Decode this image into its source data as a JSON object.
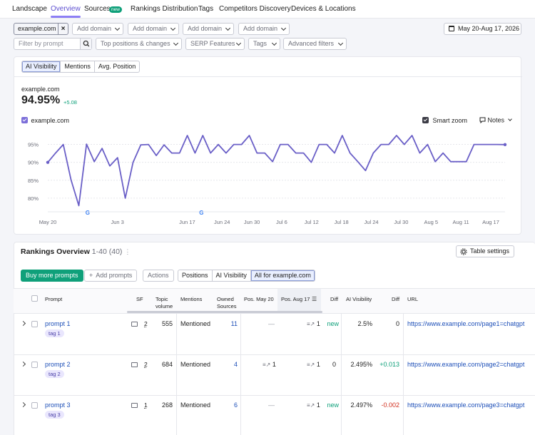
{
  "nav": {
    "tabs": [
      "Landscape",
      "Overview",
      "Sources",
      "Rankings Distribution",
      "Tags",
      "Competitors Discovery",
      "Devices & Locations"
    ],
    "active": "Overview",
    "new_badge": "new"
  },
  "filters": {
    "domain_chip": "example.com",
    "add_domain": "Add domain",
    "date_range": "May 20-Aug 17, 2026",
    "prompt_placeholder": "Filter by prompt",
    "top_positions": "Top positions & changes",
    "serp_features": "SERP Features",
    "tags": "Tags",
    "advanced_filters": "Advanced filters"
  },
  "chart_tabs": [
    "AI Visibility",
    "Mentions",
    "Avg. Position"
  ],
  "summary": {
    "domain": "example.com",
    "value": "94.95%",
    "change": "+5.08",
    "legend_label": "example.com",
    "smart_zoom": "Smart zoom",
    "notes": "Notes"
  },
  "colors": {
    "accent": "#7c6fd9",
    "line": "#6a5fc7",
    "green": "#0fa07a",
    "link": "#1d4fb8",
    "negative": "#d1301f"
  },
  "chart_data": {
    "type": "line",
    "series": [
      {
        "name": "example.com",
        "values": [
          90.0,
          92.6,
          95.0,
          85.1,
          77.9,
          95.1,
          90.2,
          93.9,
          89.0,
          91.3,
          80.0,
          90.0,
          94.9,
          95.0,
          91.9,
          94.9,
          92.6,
          92.6,
          97.5,
          92.6,
          97.5,
          92.6,
          95.0,
          92.6,
          95.0,
          95.0,
          97.5,
          92.6,
          92.6,
          90.2,
          95.0,
          95.0,
          92.6,
          92.6,
          90.0,
          95.0,
          95.0,
          92.6,
          97.5,
          92.6,
          90.2,
          87.7,
          92.6,
          95.0,
          95.0,
          97.5,
          95.0,
          97.5,
          92.6,
          95.0,
          90.2,
          92.6,
          90.2,
          90.2,
          90.2,
          95.0,
          95.0,
          95.0,
          95.0,
          94.95
        ]
      }
    ],
    "x_ticks": [
      "May 20",
      "Jun 3",
      "Jun 17",
      "Jun 24",
      "Jun 30",
      "Jul 6",
      "Jul 12",
      "Jul 18",
      "Jul 24",
      "Jul 30",
      "Aug 5",
      "Aug 11",
      "Aug 17"
    ],
    "y_ticks": [
      "95%",
      "90%",
      "85%",
      "80%"
    ],
    "ylim": [
      75,
      97.5
    ],
    "markers": [
      "G",
      "G"
    ],
    "grid": "horizontal dashed",
    "legend": "top-left"
  },
  "rankings": {
    "title": "Rankings Overview",
    "range": "1-40 (40)",
    "table_settings": "Table settings",
    "buy_prompts": "Buy more prompts",
    "add_prompts": "Add prompts",
    "actions": "Actions",
    "view_tabs": [
      "Positions",
      "AI Visibility",
      "All for example.com"
    ],
    "columns": {
      "prompt": "Prompt",
      "sf": "SF",
      "topic_volume": "Topic volume",
      "mentions": "Mentions",
      "owned_sources": "Owned Sources",
      "pos_may": "Pos. May 20",
      "pos_aug": "Pos. Aug 17",
      "diff": "Diff",
      "ai_visibility": "AI Visibility",
      "diff2": "Diff",
      "url": "URL"
    },
    "rows": [
      {
        "prompt": "prompt 1",
        "tag": "tag 1",
        "sf": "2",
        "volume": "555",
        "mentions": "Mentioned",
        "owned": "11",
        "pos_may": "—",
        "pos_aug": "1",
        "diff": "new",
        "vis": "2.5%",
        "vis_diff": "0",
        "url": "https://www.example.com/page1=chatgpt"
      },
      {
        "prompt": "prompt 2",
        "tag": "tag 2",
        "sf": "2",
        "volume": "684",
        "mentions": "Mentioned",
        "owned": "4",
        "pos_may": "1",
        "pos_aug": "1",
        "diff": "0",
        "vis": "2.495%",
        "vis_diff": "+0.013",
        "url": "https://www.example.com/page2=chatgpt"
      },
      {
        "prompt": "prompt 3",
        "tag": "tag 3",
        "sf": "1",
        "volume": "268",
        "mentions": "Mentioned",
        "owned": "6",
        "pos_may": "—",
        "pos_aug": "1",
        "diff": "new",
        "vis": "2.497%",
        "vis_diff": "-0.002",
        "url": "https://www.example.com/page3=chatgpt"
      }
    ]
  }
}
